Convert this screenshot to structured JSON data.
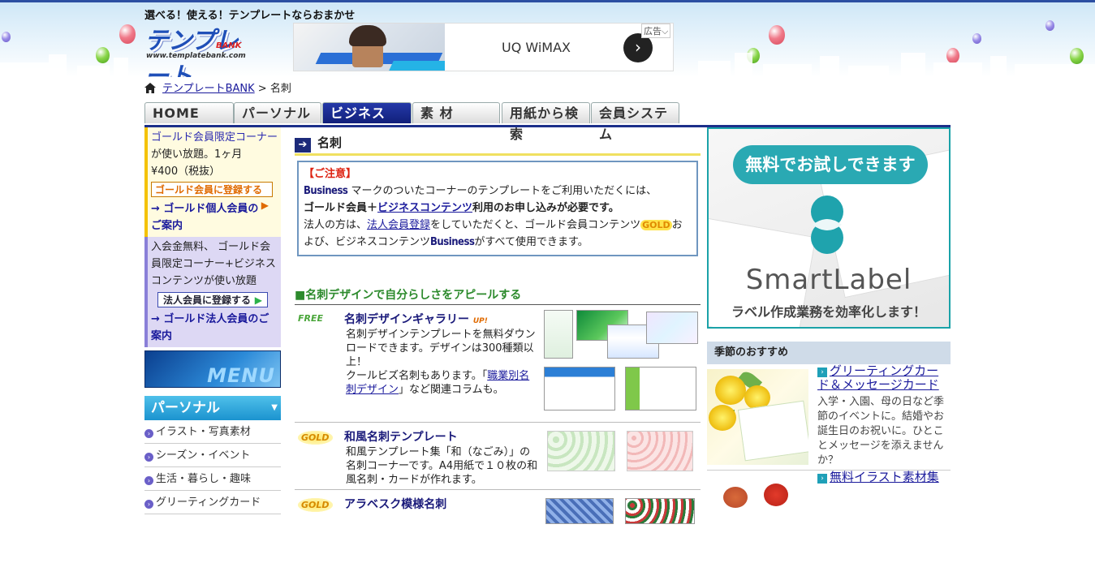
{
  "header": {
    "tagline": "選べる！使える！テンプレートならおまかせ",
    "logo_text": "テンプレート",
    "logo_url": "www.templatebank.com",
    "logo_bank": "BANK",
    "ad": {
      "text": "UQ WiMAX",
      "label": "広告"
    }
  },
  "breadcrumb": {
    "home_link": "テンプレートBANK",
    "separator": " > ",
    "current": "名刺"
  },
  "nav": {
    "tabs": [
      "HOME",
      "パーソナル",
      "ビジネス",
      "素 材",
      "用紙から検索",
      "会員システム"
    ],
    "active": "ビジネス"
  },
  "left": {
    "gold": {
      "line1": "ゴールド会員限定コーナー",
      "line2": "が使い放題。1ヶ月",
      "line3": "¥400（税抜）",
      "button": "ゴールド会員に登録する",
      "link": "→ ゴールド個人会員のご案内"
    },
    "corp": {
      "text": "入会金無料、 ゴールド会員限定コーナー+ビジネスコンテンツが使い放題",
      "button": "法人会員に登録する",
      "link": "→ ゴールド法人会員のご案内"
    },
    "menu_banner": "MENU",
    "personal_header": "パーソナル",
    "personal_items": [
      "イラスト・写真素材",
      "シーズン・イベント",
      "生活・暮らし・趣味",
      "グリーティングカード"
    ]
  },
  "main": {
    "title": "名刺",
    "notice": {
      "heading": "【ご注意】",
      "business_word": "Business",
      "line1_rest": "マークのついたコーナーのテンプレートをご利用いただくには、",
      "line2_a": "ゴールド会員＋",
      "line2_link": "ビジネスコンテンツ",
      "line2_b": "利用のお申し込みが必要です。",
      "line3_a": "法人の方は、",
      "line3_link": "法人会員登録",
      "line3_b": "をしていただくと、ゴールド会員コンテンツ",
      "gold_word": "GOLD",
      "line3_c": "および、ビジネスコンテンツ",
      "line3_d": "がすべて使用できます。"
    },
    "appeal": "■名刺デザインで自分らしさをアピールする",
    "rows": [
      {
        "badge": "FREE",
        "title": "名刺デザインギャラリー",
        "up": "UP!",
        "desc_a": "名刺デザインテンプレートを無料ダウンロードできます。デザインは300種類以上！",
        "desc_b": "クールビズ名刺もあります。「",
        "desc_link": "職業別名刺デザイン",
        "desc_c": "」など関連コラムも。"
      },
      {
        "badge": "GOLD",
        "title": "和風名刺テンプレート",
        "desc": "和風テンプレート集「和（なごみ）」の名刺コーナーです。A4用紙で１０枚の和風名刺・カードが作れます。"
      },
      {
        "badge": "GOLD",
        "title": "アラベスク模様名刺"
      }
    ]
  },
  "right": {
    "banner": {
      "pill": "無料でお試しできます",
      "name": "SmartLabel",
      "sub": "ラベル作成業務を効率化します！"
    },
    "season_header": "季節のおすすめ",
    "season_items": [
      {
        "title": "グリーティングカード＆メッセージカード",
        "desc": "入学・入園、母の日など季節のイベントに。結婚やお誕生日のお祝いに。ひとことメッセージを添えませんか？"
      },
      {
        "title": "無料イラスト素材集"
      }
    ]
  },
  "colors": {
    "nav_active": "#1c2f8a",
    "gold": "#f4c200",
    "teal": "#2aa9b3",
    "link": "#1a1a9c"
  }
}
